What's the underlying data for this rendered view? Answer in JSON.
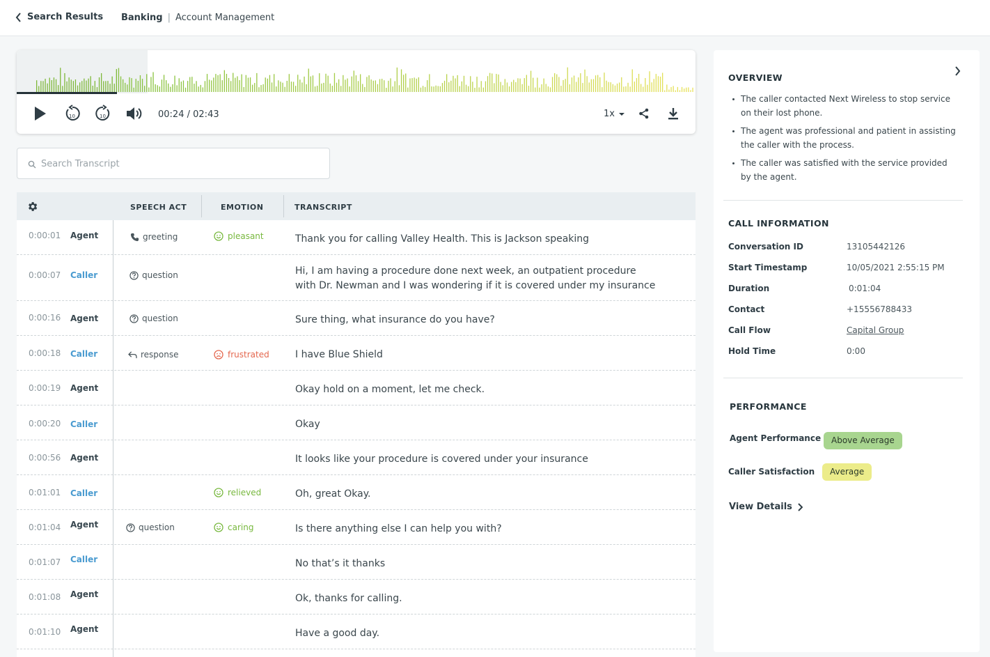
{
  "header": {
    "back_label": "Search Results",
    "breadcrumb_primary": "Banking",
    "breadcrumb_separator": "|",
    "breadcrumb_secondary": "Account Management"
  },
  "player": {
    "current_time": "00:24",
    "time_separator": "/",
    "total_time": "02:43",
    "playback_progress": 0.148,
    "speed": "1x",
    "colors": {
      "played": "#7fb83a",
      "unplayed_start": "#7fbf3d",
      "unplayed_end": "#e9e25a"
    }
  },
  "search": {
    "placeholder": "Search Transcript"
  },
  "table": {
    "columns": {
      "speech_act": "SPEECH ACT",
      "emotion": "EMOTION",
      "transcript": "TRANSCRIPT"
    },
    "rows": [
      {
        "time": "0:00:01",
        "speaker": "Agent",
        "act": "greeting",
        "act_icon": "phone-icon",
        "emotion": "pleasant",
        "emotion_tone": "good",
        "text": "Thank you for calling Valley Health. This is Jackson speaking"
      },
      {
        "time": "0:00:07",
        "speaker": "Caller",
        "act": "question",
        "act_icon": "question-icon",
        "emotion": "",
        "emotion_tone": "",
        "text": "Hi, I am having a procedure done next week, an outpatient procedure",
        "text2": "with Dr. Newman and I was wondering if it is covered under my insurance"
      },
      {
        "time": "0:00:16",
        "speaker": "Agent",
        "act": "question",
        "act_icon": "question-icon",
        "emotion": "",
        "emotion_tone": "",
        "text": "Sure thing, what insurance do you have?"
      },
      {
        "time": "0:00:18",
        "speaker": "Caller",
        "act": "response",
        "act_icon": "reply-icon",
        "emotion": "frustrated",
        "emotion_tone": "bad",
        "text": "I have Blue Shield"
      },
      {
        "time": "0:00:19",
        "speaker": "Agent",
        "act": "",
        "act_icon": "",
        "emotion": "",
        "emotion_tone": "",
        "text": "Okay hold on a moment, let me check."
      },
      {
        "time": "0:00:20",
        "speaker": "Caller",
        "act": "",
        "act_icon": "",
        "emotion": "",
        "emotion_tone": "",
        "text": "Okay"
      },
      {
        "time": "0:00:56",
        "speaker": "Agent",
        "act": "",
        "act_icon": "",
        "emotion": "",
        "emotion_tone": "",
        "text": "It looks like your procedure is covered under your insurance"
      },
      {
        "time": "0:01:01",
        "speaker": "Caller",
        "act": "",
        "act_icon": "",
        "emotion": "relieved",
        "emotion_tone": "good",
        "text": "Oh, great Okay."
      },
      {
        "time": "0:01:04",
        "speaker": "Agent",
        "act": "question",
        "act_icon": "question-icon",
        "emotion": "caring",
        "emotion_tone": "good",
        "text": "Is there anything else I can help you with?"
      },
      {
        "time": "0:01:07",
        "speaker": "Caller",
        "act": "",
        "act_icon": "",
        "emotion": "",
        "emotion_tone": "",
        "text": "No that’s it thanks"
      },
      {
        "time": "0:01:08",
        "speaker": "Agent",
        "act": "",
        "act_icon": "",
        "emotion": "",
        "emotion_tone": "",
        "text": "Ok, thanks for calling."
      },
      {
        "time": "0:01:10",
        "speaker": "Agent",
        "act": "",
        "act_icon": "",
        "emotion": "",
        "emotion_tone": "",
        "text": "Have a good day."
      }
    ]
  },
  "overview": {
    "title": "OVERVIEW",
    "bullets": [
      [
        "The caller contacted Next Wireless to stop service",
        "on their lost phone."
      ],
      [
        "The agent was professional and patient in assisting",
        "the caller with the process."
      ],
      [
        "The caller was satisfied with the service provided",
        "by the agent."
      ]
    ]
  },
  "call_info": {
    "title": "CALL INFORMATION",
    "items": [
      {
        "label": "Conversation ID",
        "value": "13105442126"
      },
      {
        "label": "Start Timestamp",
        "value": "10/05/2021 2:55:15 PM"
      },
      {
        "label": "Duration",
        "value": "0:01:04"
      },
      {
        "label": "Contact",
        "value": "+15556788433"
      },
      {
        "label": "Call Flow",
        "value": "Capital Group"
      },
      {
        "label": "Hold Time",
        "value": "0:00"
      }
    ]
  },
  "performance": {
    "title": "PERFORMANCE",
    "agent_label": "Agent Performance",
    "agent_value": "Above Average",
    "caller_label": "Caller Satisfaction",
    "caller_value": "Average",
    "view_details": "View Details",
    "colors": {
      "above_average": "#a8d58f",
      "average": "#ecec8a"
    }
  }
}
